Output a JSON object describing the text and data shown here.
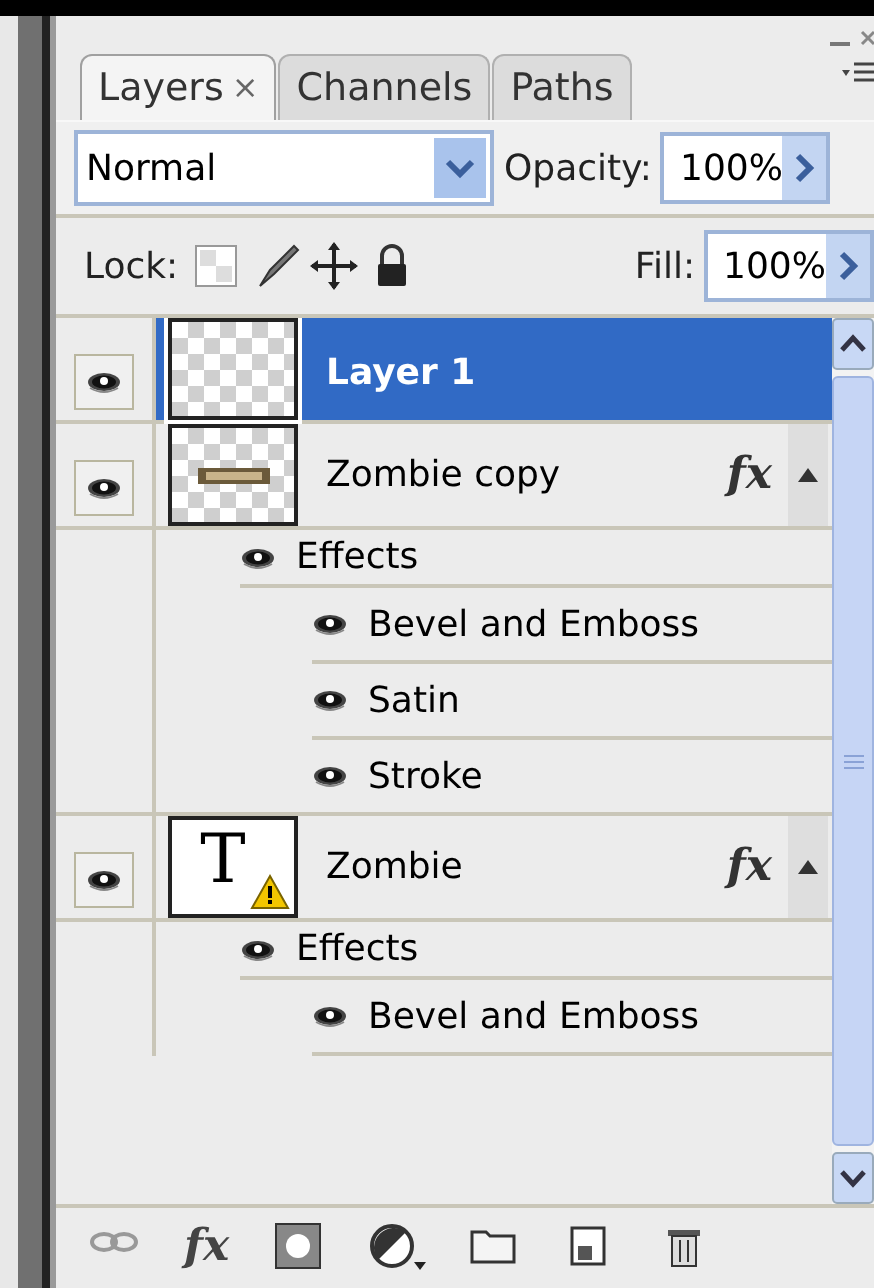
{
  "panel_tabs": [
    {
      "label": "Layers",
      "close": "×",
      "selected": true
    },
    {
      "label": "Channels",
      "selected": false
    },
    {
      "label": "Paths",
      "selected": false
    }
  ],
  "blend_mode": "Normal",
  "opacity": {
    "label": "Opacity:",
    "value": "100%"
  },
  "lock": {
    "label": "Lock:"
  },
  "fill": {
    "label": "Fill:",
    "value": "100%"
  },
  "layers": [
    {
      "name": "Layer 1",
      "selected": true,
      "visible": true,
      "thumbnail": {
        "kind": "transparent"
      }
    },
    {
      "name": "Zombie copy",
      "selected": false,
      "visible": true,
      "thumbnail": {
        "kind": "raster_text"
      },
      "fx": "fx",
      "effects": {
        "label": "Effects",
        "visible": true,
        "children": [
          {
            "name": "Bevel and Emboss",
            "visible": true
          },
          {
            "name": "Satin",
            "visible": true
          },
          {
            "name": "Stroke",
            "visible": true
          }
        ]
      }
    },
    {
      "name": "Zombie",
      "selected": false,
      "visible": true,
      "thumbnail": {
        "kind": "type",
        "glyph": "T"
      },
      "fx": "fx",
      "effects": {
        "label": "Effects",
        "visible": true,
        "children": [
          {
            "name": "Bevel and Emboss",
            "visible": true
          }
        ]
      }
    }
  ],
  "toolbar": [
    {
      "kind": "link"
    },
    {
      "kind": "fx",
      "label": "fx"
    },
    {
      "kind": "mask"
    },
    {
      "kind": "adjust"
    },
    {
      "kind": "folder"
    },
    {
      "kind": "new"
    },
    {
      "kind": "trash"
    }
  ]
}
